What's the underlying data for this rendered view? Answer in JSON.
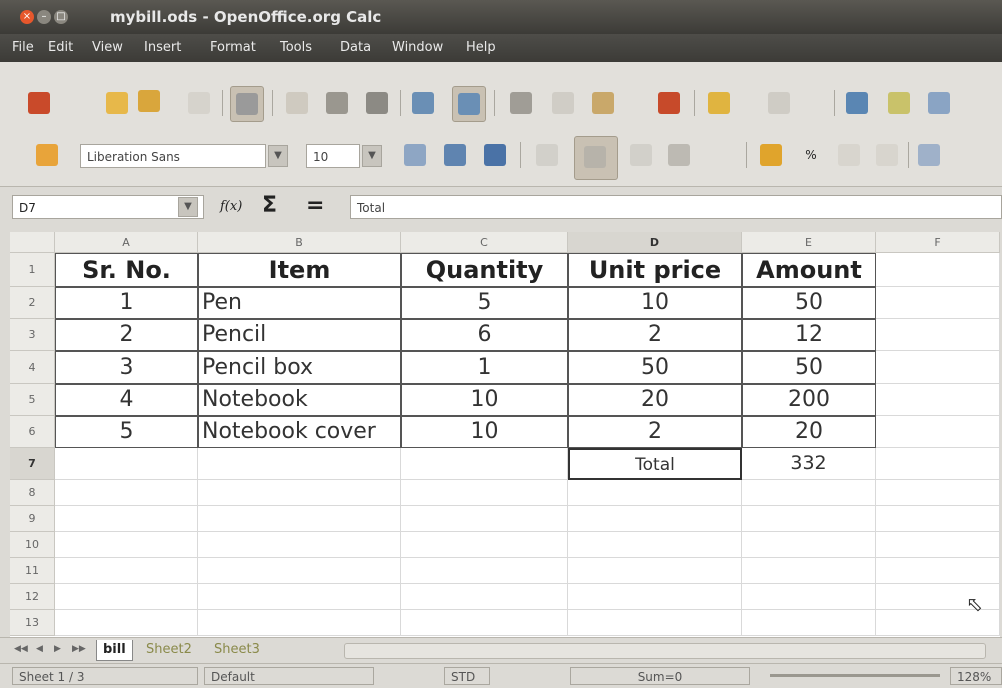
{
  "window": {
    "title": "mybill.ods - OpenOffice.org Calc"
  },
  "menu": [
    "File",
    "Edit",
    "View",
    "Insert",
    "Format",
    "Tools",
    "Data",
    "Window",
    "Help"
  ],
  "formatting": {
    "font_name": "Liberation Sans",
    "font_size": "10"
  },
  "formula_bar": {
    "cell_ref": "D7",
    "function_wizard": "f(x)",
    "sum": "Σ",
    "equals": "=",
    "content": "Total"
  },
  "columns": [
    "A",
    "B",
    "C",
    "D",
    "E",
    "F"
  ],
  "rows": [
    "1",
    "2",
    "3",
    "4",
    "5",
    "6",
    "7",
    "8",
    "9",
    "10",
    "11",
    "12",
    "13"
  ],
  "table": {
    "headers": [
      "Sr. No.",
      "Item",
      "Quantity",
      "Unit price",
      "Amount"
    ],
    "rows": [
      [
        "1",
        "Pen",
        "5",
        "10",
        "50"
      ],
      [
        "2",
        "Pencil",
        "6",
        "2",
        "12"
      ],
      [
        "3",
        "Pencil box",
        "1",
        "50",
        "50"
      ],
      [
        "4",
        "Notebook",
        "10",
        "20",
        "200"
      ],
      [
        "5",
        "Notebook cover",
        "10",
        "2",
        "20"
      ]
    ],
    "total_label": "Total",
    "total_value": "332"
  },
  "sheet_tabs": [
    "bill",
    "Sheet2",
    "Sheet3"
  ],
  "status": {
    "sheet": "Sheet 1 / 3",
    "style": "Default",
    "mode": "STD",
    "sum": "Sum=0",
    "zoom": "128%"
  },
  "colors": {
    "accent": "#e6572c",
    "selection": "#c9c1b3"
  }
}
